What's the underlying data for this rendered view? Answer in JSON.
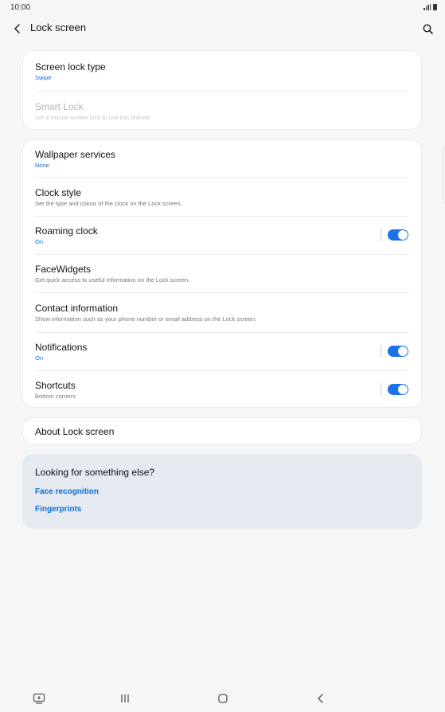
{
  "status_bar": {
    "time": "10:00"
  },
  "app_bar": {
    "title": "Lock screen"
  },
  "group1": [
    {
      "title": "Screen lock type",
      "subtitle": "Swipe"
    },
    {
      "title": "Smart Lock",
      "subtitle": "Set a secure screen lock to use this feature."
    }
  ],
  "group2": [
    {
      "title": "Wallpaper services",
      "subtitle": "None"
    },
    {
      "title": "Clock style",
      "subtitle": "Set the type and colour of the clock on the Lock screen."
    },
    {
      "title": "Roaming clock",
      "subtitle": "On",
      "toggle": true
    },
    {
      "title": "FaceWidgets",
      "subtitle": "Get quick access to useful information on the Lock screen."
    },
    {
      "title": "Contact information",
      "subtitle": "Show information such as your phone number or email address on the Lock screen."
    },
    {
      "title": "Notifications",
      "subtitle": "On",
      "toggle": true
    },
    {
      "title": "Shortcuts",
      "subtitle": "Bottom corners",
      "toggle": true
    }
  ],
  "about": {
    "title": "About Lock screen"
  },
  "suggestions": {
    "title": "Looking for something else?",
    "links": [
      "Face recognition",
      "Fingerprints"
    ]
  },
  "colors": {
    "accent": "#0a6fd6",
    "toggle_on": "#1a73e8",
    "background": "#f6f6f6",
    "suggest_bg": "#e5e9f0"
  },
  "icons": {
    "back": "chevron-left-icon",
    "search": "search-icon",
    "nav": [
      "keyboard-switch-icon",
      "recent-apps-icon",
      "home-icon",
      "back-icon"
    ]
  }
}
